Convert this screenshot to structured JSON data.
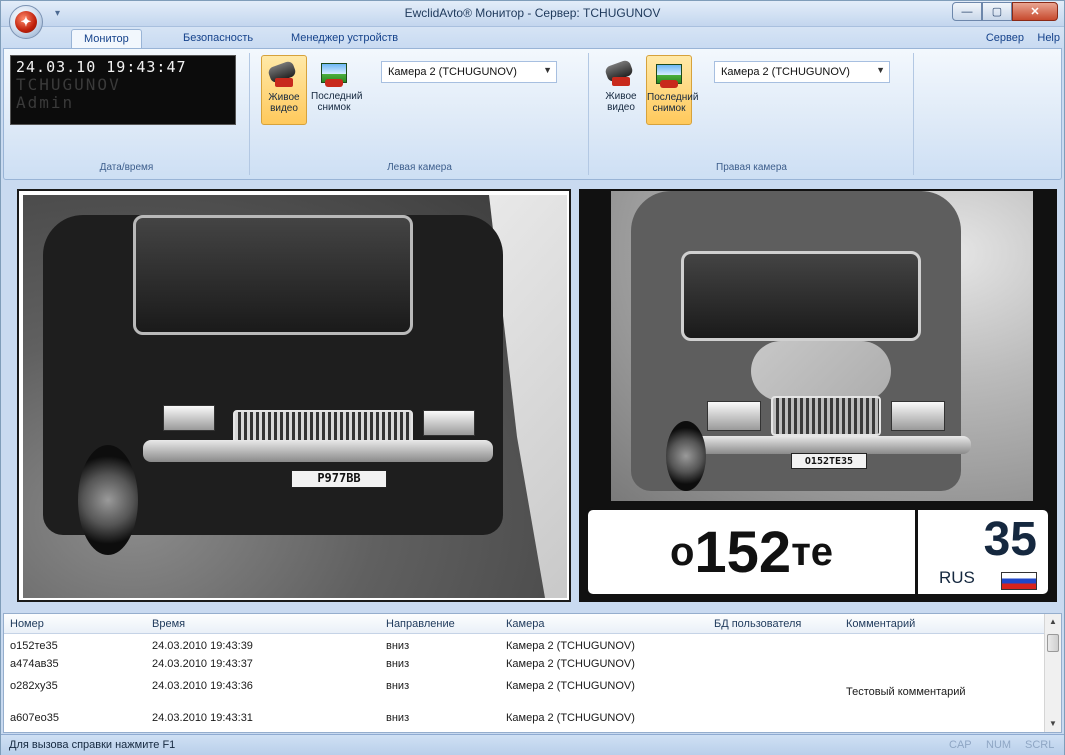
{
  "window": {
    "title": "EwclidAvto® Монитор - Сервер: TCHUGUNOV",
    "orb_glyph": "✦",
    "qat_glyph": "▾",
    "minimize_glyph": "—",
    "maximize_glyph": "▢",
    "close_glyph": "✕"
  },
  "tabs": [
    {
      "label": "Монитор",
      "active": true
    },
    {
      "label": "Безопасность",
      "active": false
    },
    {
      "label": "Менеджер устройств",
      "active": false
    }
  ],
  "menu": {
    "server": "Сервер",
    "help": "Help"
  },
  "ribbon": {
    "datetime": {
      "clock": "24.03.10 19:43:47",
      "server": "TCHUGUNOV",
      "user": "Admin",
      "group_label": "Дата/время"
    },
    "left_camera": {
      "live_label": "Живое видео",
      "snapshot_label": "Последний снимок",
      "camera": "Камера 2 (TCHUGUNOV)",
      "group_label": "Левая камера",
      "active_button": "live"
    },
    "right_camera": {
      "live_label": "Живое видео",
      "snapshot_label": "Последний снимок",
      "camera": "Камера 2 (TCHUGUNOV)",
      "group_label": "Правая камера",
      "active_button": "snapshot"
    }
  },
  "video": {
    "left_plate": "P977BB",
    "right_plate": "O152TE35",
    "recognized_plate": {
      "prefix": "о",
      "number": "152",
      "suffix": "те",
      "region": "35",
      "country": "RUS"
    }
  },
  "table": {
    "columns": [
      "Номер",
      "Время",
      "Направление",
      "Камера",
      "БД пользователя",
      "Комментарий"
    ],
    "rows": [
      {
        "number": "о152те35",
        "time": "24.03.2010 19:43:39",
        "direction": "вниз",
        "camera": "Камера 2 (TCHUGUNOV)",
        "db": "",
        "comment": ""
      },
      {
        "number": "а474ав35",
        "time": "24.03.2010 19:43:37",
        "direction": "вниз",
        "camera": "Камера 2 (TCHUGUNOV)",
        "db": "",
        "comment": ""
      },
      {
        "number": "о282ху35",
        "time": "24.03.2010 19:43:36",
        "direction": "вниз",
        "camera": "Камера 2 (TCHUGUNOV)",
        "db": "",
        "comment": "Тестовый комментарий"
      },
      {
        "number": "а607ео35",
        "time": "24.03.2010 19:43:31",
        "direction": "вниз",
        "camera": "Камера 2 (TCHUGUNOV)",
        "db": "",
        "comment": ""
      }
    ]
  },
  "statusbar": {
    "hint": "Для вызова справки нажмите F1",
    "cap": "CAP",
    "num": "NUM",
    "scrl": "SCRL"
  },
  "colors": {
    "ribbon_accent": "#15428b",
    "active_button": "#ffc95c",
    "close_button": "#c74a2e"
  },
  "icons": {
    "live": "camera-icon",
    "snapshot": "image-icon",
    "combo": "chevron-down-icon",
    "flag": "russia-flag-icon"
  }
}
